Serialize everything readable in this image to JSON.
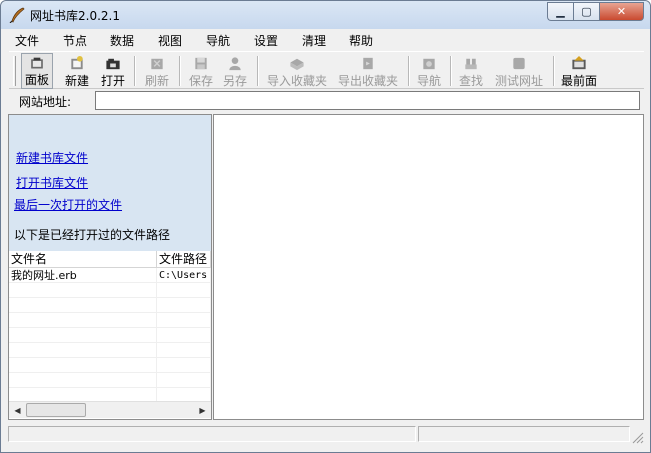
{
  "window": {
    "title": "网址书库2.0.2.1",
    "buttons": {
      "minimize": "▁",
      "maximize": "▢",
      "close": "✕"
    }
  },
  "menu": [
    "文件",
    "节点",
    "数据",
    "视图",
    "导航",
    "设置",
    "清理",
    "帮助"
  ],
  "toolbar": {
    "buttons": [
      {
        "label": "面板",
        "icon": "panel-icon",
        "state": "pressed"
      },
      {
        "label": "新建",
        "icon": "new-icon",
        "state": "enabled"
      },
      {
        "label": "打开",
        "icon": "open-icon",
        "state": "enabled"
      },
      {
        "label": "刷新",
        "icon": "refresh-icon",
        "state": "disabled"
      },
      {
        "label": "保存",
        "icon": "save-icon",
        "state": "disabled"
      },
      {
        "label": "另存",
        "icon": "save-as-icon",
        "state": "disabled"
      },
      {
        "label": "导入收藏夹",
        "icon": "import-favorites-icon",
        "state": "disabled"
      },
      {
        "label": "导出收藏夹",
        "icon": "export-favorites-icon",
        "state": "disabled"
      },
      {
        "label": "导航",
        "icon": "navigate-icon",
        "state": "disabled"
      },
      {
        "label": "查找",
        "icon": "find-icon",
        "state": "disabled"
      },
      {
        "label": "测试网址",
        "icon": "test-url-icon",
        "state": "disabled"
      },
      {
        "label": "最前面",
        "icon": "topmost-icon",
        "state": "enabled"
      }
    ]
  },
  "address": {
    "label": "网站地址:",
    "value": ""
  },
  "left_panel": {
    "links": [
      "新建书库文件",
      "打开书库文件",
      "最后一次打开的文件"
    ],
    "hint": "以下是已经打开过的文件路径",
    "list": {
      "columns": [
        "文件名",
        "文件路径"
      ],
      "rows": [
        {
          "name": "我的网址.erb",
          "path": "C:\\Users"
        }
      ]
    }
  },
  "colors": {
    "link": "#0000cc",
    "panel_bg": "#d8e5f2",
    "window_bg": "#f0f0f0"
  }
}
